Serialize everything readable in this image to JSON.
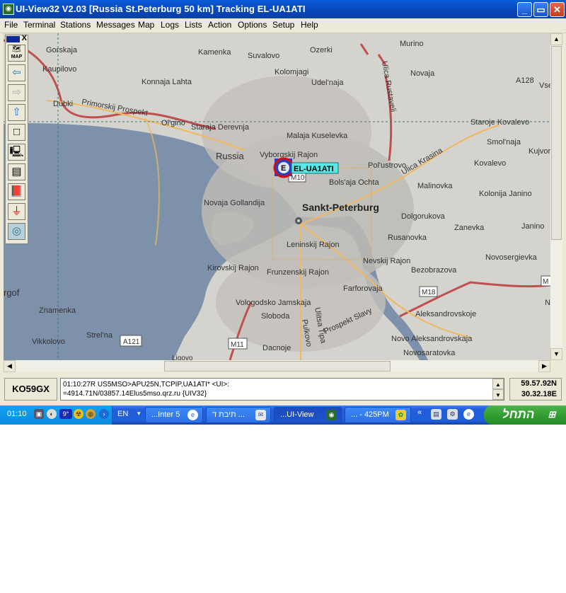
{
  "window": {
    "title": "UI-View32 V2.03 [Russia St.Peterburg 50 km]  Tracking EL-UA1ATI",
    "controls": {
      "minimize": "_",
      "maximize": "▭",
      "close": "✕"
    }
  },
  "menu": [
    "File",
    "Terminal",
    "Stations",
    "Messages",
    "Map",
    "Logs",
    "Lists",
    "Action",
    "Options",
    "Setup",
    "Help"
  ],
  "toolbar": {
    "close": "X",
    "tools": [
      {
        "name": "map-tool-icon",
        "glyph": "🗺",
        "label": "MAP"
      },
      {
        "name": "arrow-left-icon",
        "glyph": "⇦"
      },
      {
        "name": "arrow-right-icon",
        "glyph": "⇨"
      },
      {
        "name": "arrow-up-icon",
        "glyph": "⇧"
      },
      {
        "name": "square-icon",
        "glyph": "□"
      },
      {
        "name": "computer-icon",
        "glyph": "🖳"
      },
      {
        "name": "list-icon",
        "glyph": "▤"
      },
      {
        "name": "book-icon",
        "glyph": "📕"
      },
      {
        "name": "antenna-icon",
        "glyph": "⏚"
      },
      {
        "name": "globe-icon",
        "glyph": "◎"
      }
    ]
  },
  "map": {
    "labels": [
      "Gorskaja",
      "Kaupilovo",
      "Dubki",
      "Primorskij Prospekt",
      "Konnaja Lahta",
      "Ol'gino",
      "Staraja Derevnja",
      "Kamenka",
      "Suvalovo",
      "Kolomjagi",
      "Ozerki",
      "Udel'naja",
      "Murino",
      "Novaja",
      "Ulica Rustaveli",
      "A128",
      "Vse",
      "Staroje Kovalevo",
      "Smol'naja",
      "Kujvor",
      "Malaja Kuselevka",
      "Russia",
      "Vyborgskij Rajon",
      "Pol'ustrovo",
      "Ulica Krasina",
      "Kovalevo",
      "Bols'aja Ochta",
      "Malinovka",
      "Kolonija Janino",
      "Janino",
      "M10",
      "Sankt-Peterburg",
      "Novaja Gollandija",
      "Dolgorukova",
      "Zanevka",
      "Rusanovka",
      "Novosergievka",
      "Leninskij Rajon",
      "Nevskij Rajon",
      "Bezobrazova",
      "Kirovskij Rajon",
      "Frunzenskij Rajon",
      "Farforovaja",
      "M18",
      "Aleksandrovskoje",
      "N",
      "M",
      "Vologodsko Jamskaja",
      "Sloboda",
      "Ulitsa Tipa",
      "Pulkovo",
      "Prospekt Slavy",
      "Novo Aleksandrovskaja",
      "Novosaratovka",
      "rgof",
      "Znamenka",
      "Strel'na",
      "Vikkolovo",
      "A121",
      "M11",
      "Dacnoje",
      "Ligovo"
    ],
    "station": {
      "symbol": "E",
      "callsign": "EL-UA1ATI"
    },
    "colors": {
      "water": "#7a8fa8",
      "land": "#d4d3cd",
      "city": "#b8b6b0",
      "highway": "#c05050",
      "road": "#f0b860"
    }
  },
  "status": {
    "locator": "KO59GX",
    "message_line1": "01:10:27R US5MSO>APU25N,TCPIP,UA1ATI* <UI>:",
    "message_line2": "=4914.71N/03857.14Elus5mso.qrz.ru {UIV32}",
    "lat": "59.57.92N",
    "lon": "30.32.18E"
  },
  "taskbar": {
    "clock": "01:10",
    "temp": "9°",
    "language": "EN",
    "tasks": [
      {
        "label": "...Inter  5",
        "icon": "ie-icon"
      },
      {
        "label": "תיבת ד ...",
        "icon": "outlook-icon"
      },
      {
        "label": "...UI-View",
        "icon": "uiview-icon"
      },
      {
        "label": "... - 425PM",
        "icon": "butterfly-icon"
      }
    ],
    "start": "התחל"
  }
}
